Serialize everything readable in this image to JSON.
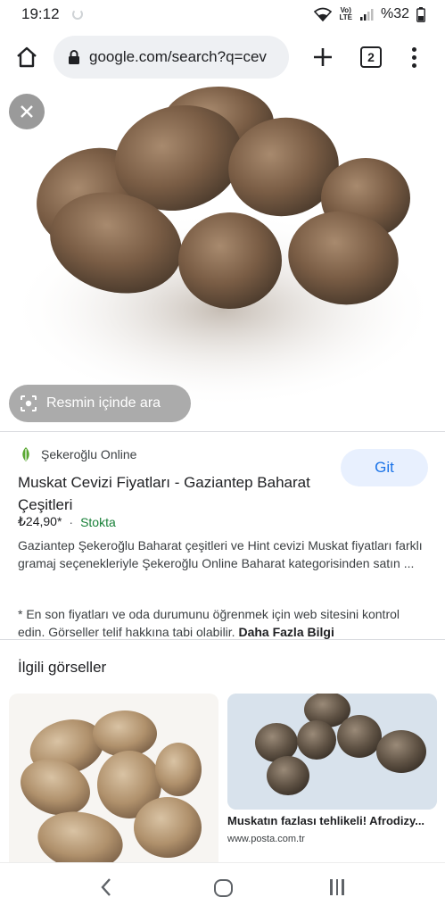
{
  "status_bar": {
    "time": "19:12",
    "network": "LTE",
    "battery": "%32"
  },
  "toolbar": {
    "url": "google.com/search?q=cev",
    "tab_count": "2"
  },
  "image_viewer": {
    "lens_label": "Resmin içinde ara"
  },
  "result": {
    "source": "Şekeroğlu Online",
    "title": "Muskat Cevizi Fiyatları - Gaziantep Baharat Çeşitleri",
    "price": "₺24,90*",
    "stock": "Stokta",
    "visit_label": "Git",
    "description": "Gaziantep Şekeroğlu Baharat çeşitleri ve Hint cevizi Muskat fiyatları farklı gramaj seçenekleriyle Şekeroğlu Online Baharat kategorisinden satın ...",
    "note": "* En son fiyatları ve oda durumunu öğrenmek için web sitesini kontrol edin. Görseller telif hakkına tabi olabilir.",
    "note_link": "Daha Fazla Bilgi"
  },
  "related": {
    "title": "İlgili görseller",
    "items": [
      {
        "caption": "",
        "domain": ""
      },
      {
        "caption": "Muskatın fazlası tehlikeli! Afrodizy...",
        "domain": "www.posta.com.tr"
      }
    ]
  },
  "colors": {
    "accent": "#1a73e8",
    "stock": "#188038",
    "chip": "#e8f0fe"
  }
}
